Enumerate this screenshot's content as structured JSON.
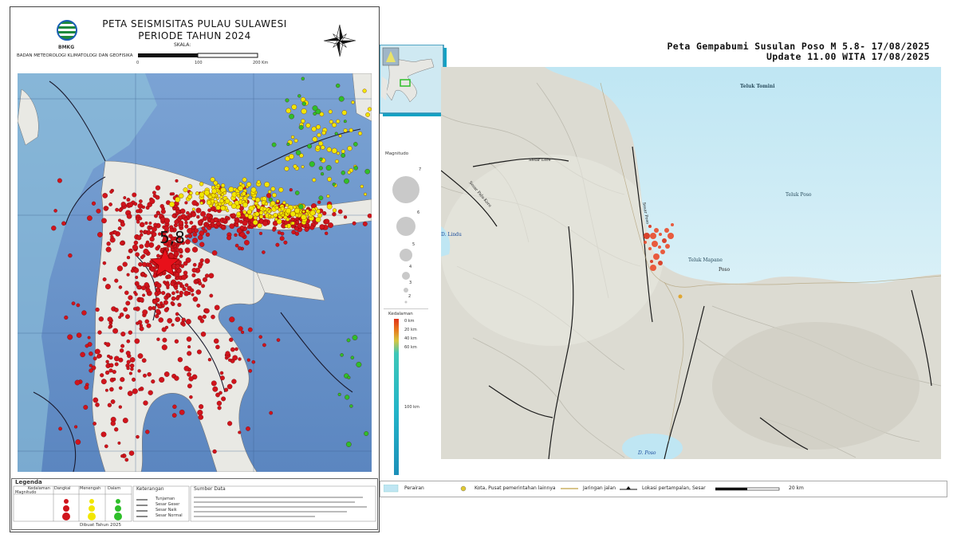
{
  "left": {
    "title_line1": "PETA SEISMISITAS PULAU SULAWESI",
    "title_line2": "PERIODE TAHUN 2024",
    "scale_label": "SKALA:",
    "scale_ticks": [
      "0",
      "100",
      "200 Km"
    ],
    "logo_text": "BMKG",
    "agency": "BADAN METEOROLOGI KLIMATOLOGI DAN GEOFISIKA",
    "star_label": "5,8",
    "legend": {
      "title": "Legenda",
      "depth_headers": [
        "Dangkal",
        "Menengah",
        "Dalam"
      ],
      "col_label": "Kedalaman",
      "row_label": "Magnitudo",
      "keterangan_title": "Keterangan",
      "keterangan_items": [
        "Tunjaman",
        "Sesar Geser",
        "Sesar Naik",
        "Sesar Normal"
      ],
      "sumber_title": "Sumber Data",
      "footer": "Dibuat Tahun 2025"
    },
    "colors": {
      "shallow": "#d0141c",
      "intermediate": "#f2e600",
      "deep": "#2fbf2a",
      "star": "#e8101a",
      "sea": "#6a93c6"
    }
  },
  "right": {
    "title_line1": "Peta Gempabumi Susulan Poso  M 5.8- 17/08/2025",
    "title_line2": "Update 11.00 WITA 17/08/2025",
    "place_labels": [
      "Teluk Tomini",
      "Teluk Poso",
      "Teluk Mapane",
      "Poso",
      "D. Lindu",
      "D. Poso",
      "Sesar Lore",
      "Sesar Palu-Koro",
      "Sesar Poso"
    ],
    "magnitude_title": "Magnitudo",
    "magnitude_values": [
      "7",
      "6",
      "5",
      "4",
      "3",
      "2"
    ],
    "depth_title": "Kedalaman",
    "depth_ticks": [
      "0 km",
      "20 km",
      "40 km",
      "60 km",
      "100 km"
    ],
    "legend_items": [
      "Perairan",
      "Kota, Pusat pemerintahan lainnya",
      "Jaringan jalan",
      "Lokasi pertampalan, Sesar"
    ],
    "scale_label": "20 km"
  }
}
